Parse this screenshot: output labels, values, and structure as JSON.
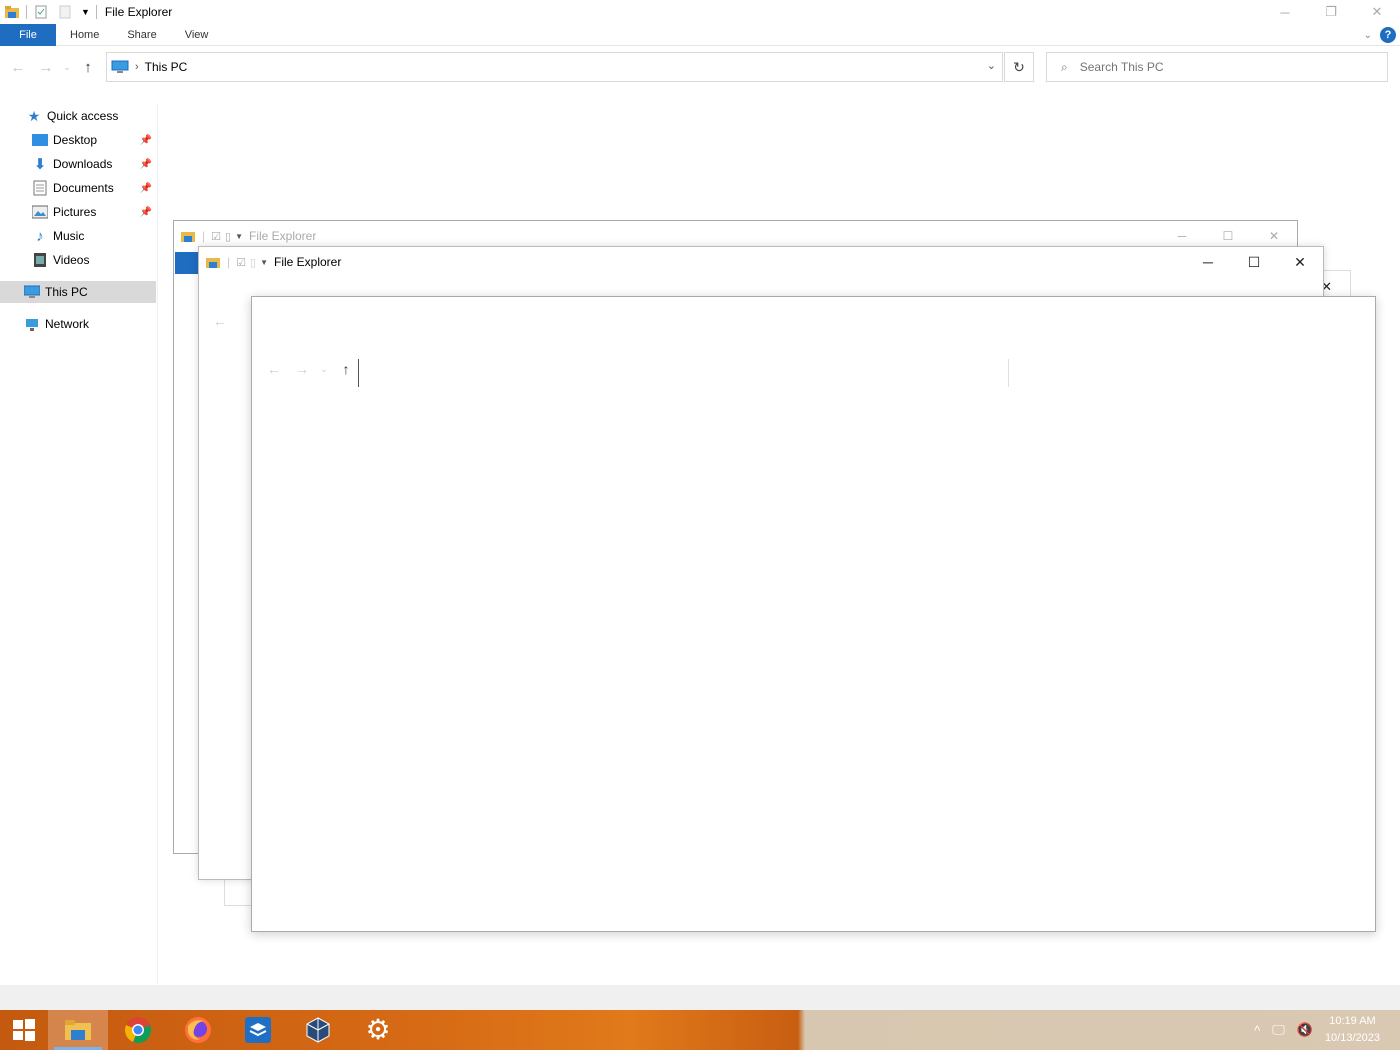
{
  "window": {
    "title": "File Explorer"
  },
  "ribbon": {
    "tabs": [
      "File",
      "Home",
      "Share",
      "View"
    ]
  },
  "address": {
    "path": "This PC"
  },
  "search": {
    "placeholder": "Search This PC"
  },
  "sidebar": {
    "quick_access": "Quick access",
    "items": [
      {
        "label": "Desktop",
        "pinned": true
      },
      {
        "label": "Downloads",
        "pinned": true
      },
      {
        "label": "Documents",
        "pinned": true
      },
      {
        "label": "Pictures",
        "pinned": true
      },
      {
        "label": "Music",
        "pinned": false
      },
      {
        "label": "Videos",
        "pinned": false
      }
    ],
    "this_pc": "This PC",
    "network": "Network"
  },
  "background_windows": [
    {
      "title": "File Explorer"
    },
    {
      "title": "File Explorer"
    }
  ],
  "taskbar": {
    "apps": [
      "start",
      "file-explorer",
      "chrome",
      "firefox",
      "virtualbox",
      "box-app",
      "settings"
    ],
    "clock_time": "10:19 AM",
    "clock_date": "10/13/2023"
  },
  "colors": {
    "accent": "#1e6dc0",
    "taskbar": "#d66a15"
  }
}
